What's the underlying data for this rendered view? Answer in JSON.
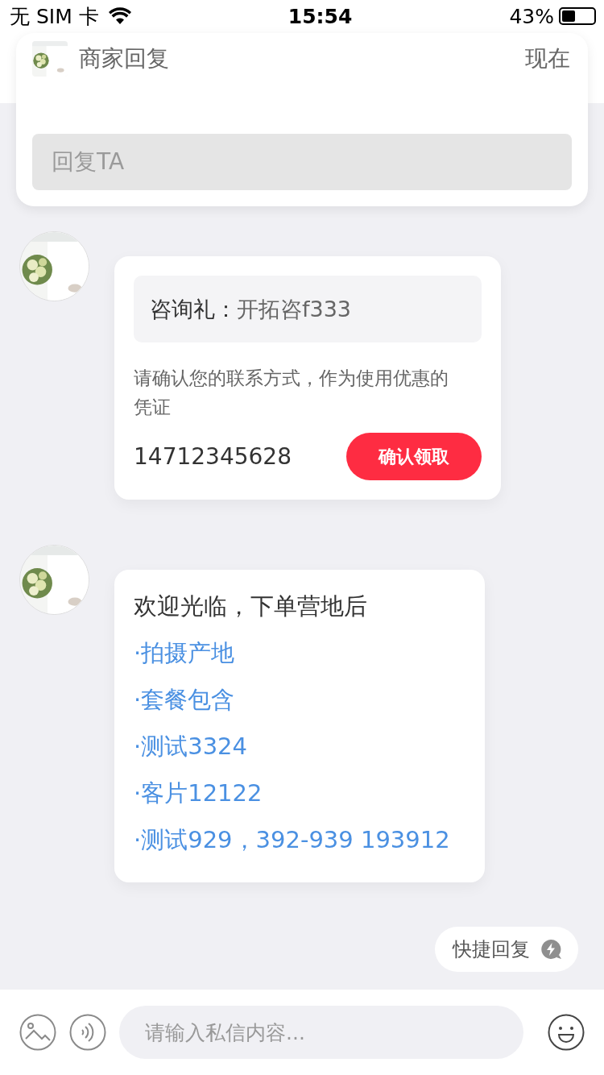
{
  "status_bar": {
    "carrier": "无 SIM 卡",
    "time": "15:54",
    "battery": "43%"
  },
  "notification": {
    "title": "商家回复",
    "time": "现在",
    "reply_placeholder": "回复TA"
  },
  "messages": [
    {
      "kind": "coupon",
      "gift_label": "咨询礼：",
      "gift_name": "开拓咨f333",
      "description": "请确认您的联系方式，作为使用优惠的凭证",
      "phone": "14712345628",
      "button": "确认领取"
    },
    {
      "kind": "text",
      "heading": "欢迎光临，下单营地后",
      "links": [
        "·拍摄产地",
        "·套餐包含",
        "·测试3324",
        "·客片12122",
        "·测试929，392-939 193912"
      ]
    }
  ],
  "quick_reply": "快捷回复",
  "input": {
    "placeholder": "请输入私信内容..."
  }
}
